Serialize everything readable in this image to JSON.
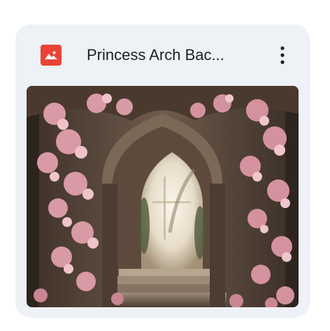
{
  "file_card": {
    "title": "Princess Arch Bac...",
    "type_icon": "image-file-icon",
    "menu_icon": "more-vert-icon",
    "thumbnail_alt": "Pink roses covering a stone gothic arch with stairs leading to a bright window",
    "colors": {
      "card_background": "#eef1f6",
      "type_icon_red": "#ea4335",
      "title_text": "#1f1f1f"
    }
  }
}
